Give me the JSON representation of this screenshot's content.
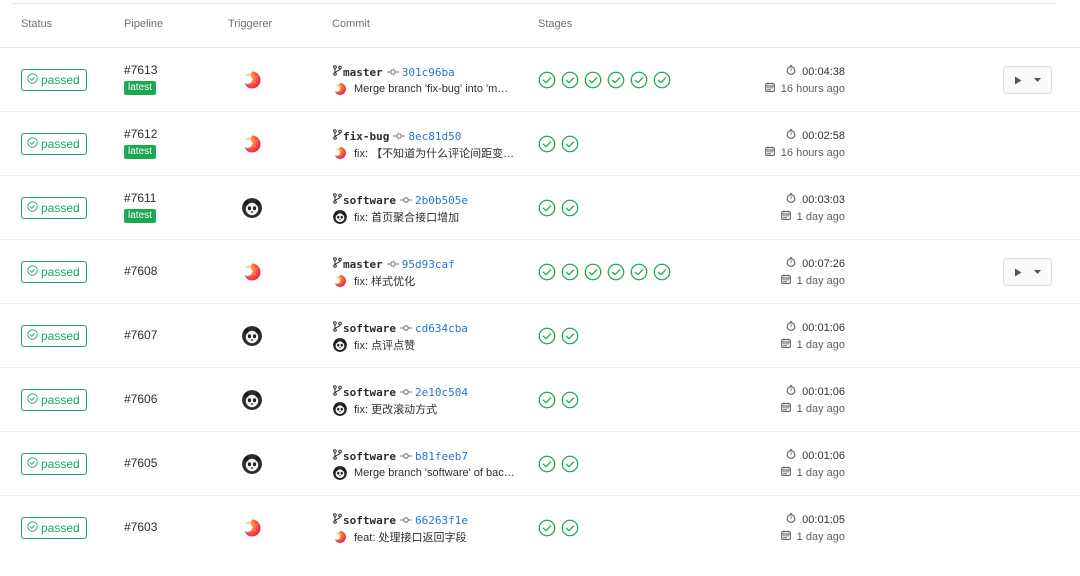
{
  "header": {
    "status": "Status",
    "pipeline": "Pipeline",
    "triggerer": "Triggerer",
    "commit": "Commit",
    "stages": "Stages"
  },
  "colors": {
    "success": "#1aaa55",
    "link": "#1f78d1"
  },
  "rows": [
    {
      "status": "passed",
      "pipeline": "#7613",
      "latest": "latest",
      "triggerer": "orange-avatar",
      "branch": "master",
      "sha": "301c96ba",
      "message": "Merge branch 'fix-bug' into 'm…",
      "stages": 6,
      "duration": "00:04:38",
      "time_ago": "16 hours ago",
      "has_play": true
    },
    {
      "status": "passed",
      "pipeline": "#7612",
      "latest": "latest",
      "triggerer": "orange-avatar",
      "branch": "fix-bug",
      "sha": "8ec81d50",
      "message": "fix: 【不知道为什么评论间距变…",
      "stages": 2,
      "duration": "00:02:58",
      "time_ago": "16 hours ago",
      "has_play": false
    },
    {
      "status": "passed",
      "pipeline": "#7611",
      "latest": "latest",
      "triggerer": "panda-avatar",
      "branch": "software",
      "sha": "2b0b505e",
      "message": "fix: 首页聚合接口增加",
      "stages": 2,
      "duration": "00:03:03",
      "time_ago": "1 day ago",
      "has_play": false
    },
    {
      "status": "passed",
      "pipeline": "#7608",
      "latest": "",
      "triggerer": "orange-avatar",
      "branch": "master",
      "sha": "95d93caf",
      "message": "fix: 样式优化",
      "stages": 6,
      "duration": "00:07:26",
      "time_ago": "1 day ago",
      "has_play": true
    },
    {
      "status": "passed",
      "pipeline": "#7607",
      "latest": "",
      "triggerer": "panda-avatar",
      "branch": "software",
      "sha": "cd634cba",
      "message": "fix: 点评点赞",
      "stages": 2,
      "duration": "00:01:06",
      "time_ago": "1 day ago",
      "has_play": false
    },
    {
      "status": "passed",
      "pipeline": "#7606",
      "latest": "",
      "triggerer": "panda-avatar",
      "branch": "software",
      "sha": "2e10c504",
      "message": "fix: 更改滚动方式",
      "stages": 2,
      "duration": "00:01:06",
      "time_ago": "1 day ago",
      "has_play": false
    },
    {
      "status": "passed",
      "pipeline": "#7605",
      "latest": "",
      "triggerer": "panda-avatar",
      "branch": "software",
      "sha": "b81feeb7",
      "message": "Merge branch 'software' of bac…",
      "stages": 2,
      "duration": "00:01:06",
      "time_ago": "1 day ago",
      "has_play": false
    },
    {
      "status": "passed",
      "pipeline": "#7603",
      "latest": "",
      "triggerer": "orange-avatar",
      "branch": "software",
      "sha": "66263f1e",
      "message": "feat: 处理接口返回字段",
      "stages": 2,
      "duration": "00:01:05",
      "time_ago": "1 day ago",
      "has_play": false
    }
  ]
}
